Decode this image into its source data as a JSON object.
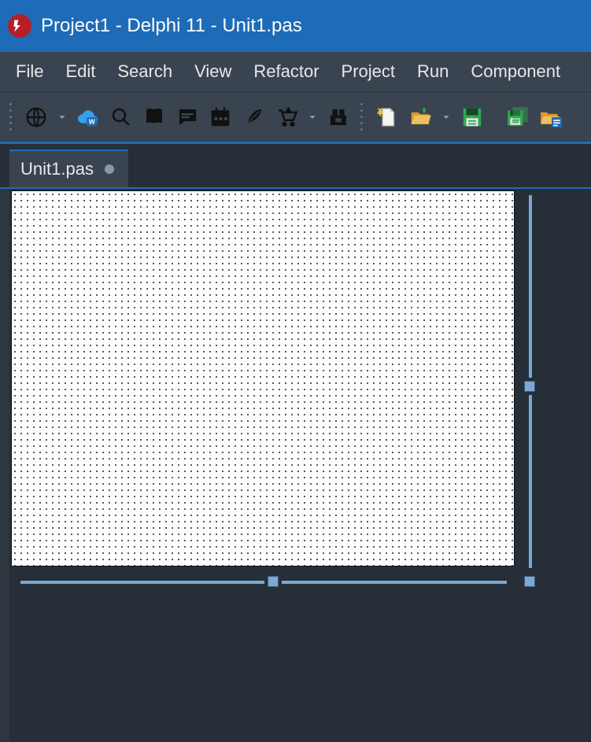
{
  "title": "Project1 - Delphi 11 - Unit1.pas",
  "menu": {
    "file": "File",
    "edit": "Edit",
    "search": "Search",
    "view": "View",
    "refactor": "Refactor",
    "project": "Project",
    "run": "Run",
    "component": "Component"
  },
  "toolbar_icons": {
    "globe": "globe-icon",
    "cloud": "cloud-word-icon",
    "search": "search-icon",
    "book": "book-icon",
    "comment": "comment-icon",
    "calendar": "calendar-icon",
    "feather": "feather-icon",
    "cart": "cart-icon",
    "package": "package-icon",
    "newfile": "new-file-icon",
    "openfolder": "open-folder-icon",
    "save": "save-icon",
    "saveall": "save-all-icon",
    "folderfile": "open-project-icon"
  },
  "tab": {
    "label": "Unit1.pas"
  },
  "colors": {
    "titlebar": "#1e6bb8",
    "menubar": "#3a4450",
    "designer_bg": "#262e38",
    "handle": "#7aa9d6",
    "save_green": "#2fa84f",
    "folder_orange": "#d99a2b",
    "newfile_yellow": "#f0c43c"
  }
}
